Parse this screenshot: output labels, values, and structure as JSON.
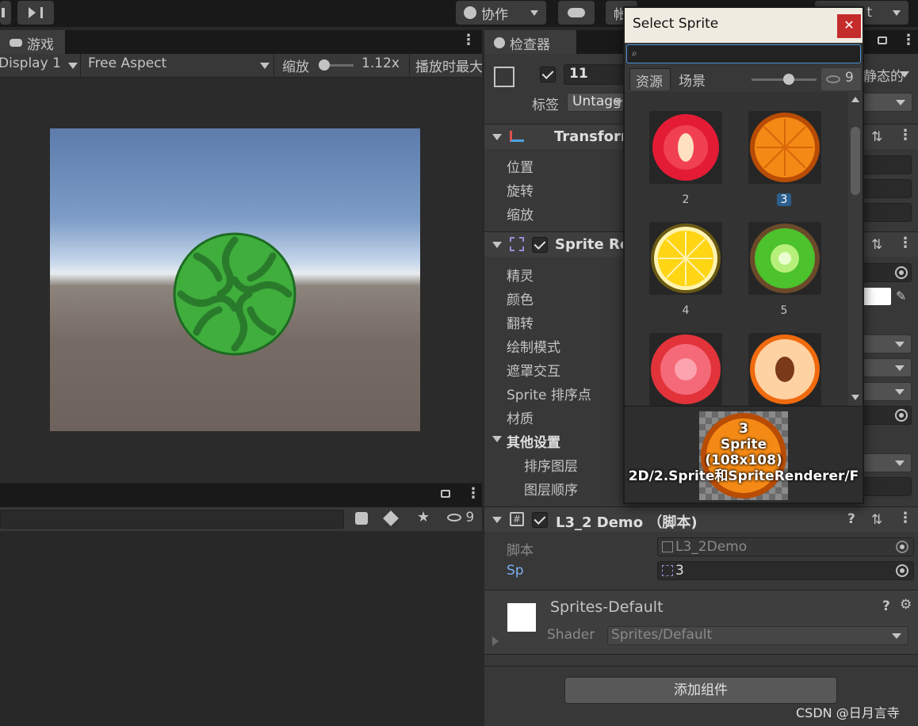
{
  "toolbar": {
    "collab_label": "协作",
    "account_label": "帐",
    "right_fragment": "t"
  },
  "game_panel": {
    "tab_label": "游戏",
    "display_label": "Display 1",
    "aspect_label": "Free Aspect",
    "scale_label": "缩放",
    "scale_value": "1.12x",
    "play_max_label": "播放时最大"
  },
  "project_panel": {
    "hidden_count": "9"
  },
  "inspector": {
    "tab_label": "检查器",
    "object_name": "11",
    "static_label": "静态的",
    "tag_label": "标签",
    "tag_value": "Untagg",
    "transform": {
      "title": "Transform",
      "rows": [
        "位置",
        "旋转",
        "缩放"
      ]
    },
    "sprite_renderer": {
      "title": "Sprite Ren",
      "rows": [
        "精灵",
        "颜色",
        "翻转",
        "绘制模式",
        "遮罩交互",
        "Sprite 排序点",
        "材质"
      ],
      "other_settings": "其他设置",
      "sort_layer": "排序图层",
      "layer_order": "图层顺序"
    },
    "script": {
      "title": "L3_2 Demo （脚本)",
      "script_label": "脚本",
      "script_value": "L3_2Demo",
      "sp_label": "Sp",
      "sp_value": "3"
    },
    "material": {
      "name": "Sprites-Default",
      "shader_label": "Shader",
      "shader_value": "Sprites/Default"
    },
    "add_component": "添加组件"
  },
  "select_sprite": {
    "title": "Select Sprite",
    "search_placeholder": "",
    "tab_assets": "资源",
    "tab_scene": "场景",
    "hidden_count": "9",
    "items": [
      {
        "label": "2",
        "fruit": "strawberry"
      },
      {
        "label": "3",
        "fruit": "orange",
        "selected": true
      },
      {
        "label": "4",
        "fruit": "lemon"
      },
      {
        "label": "5",
        "fruit": "kiwi"
      },
      {
        "label": "",
        "fruit": "tomato"
      },
      {
        "label": "",
        "fruit": "peach"
      }
    ],
    "preview": {
      "name": "3",
      "type": "Sprite",
      "size": "(108x108)",
      "path": "2D/2.Sprite和SpriteRenderer/F"
    }
  },
  "watermark": "CSDN @日月言寺"
}
